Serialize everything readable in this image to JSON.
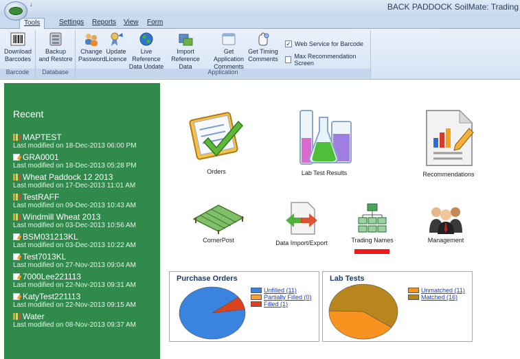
{
  "window": {
    "title": "BACK PADDOCK SoilMate: Trading"
  },
  "qat": {
    "glyph": "↓"
  },
  "menu": {
    "tabs": [
      "Tools",
      "Settings",
      "Reports",
      "View",
      "Form"
    ]
  },
  "ribbon": {
    "groups": [
      {
        "label": "Barcode",
        "buttons": [
          {
            "l1": "Download",
            "l2": "Barcodes"
          }
        ]
      },
      {
        "label": "Database",
        "buttons": [
          {
            "l1": "Backup",
            "l2": "and Restore"
          }
        ]
      },
      {
        "label": "Application",
        "buttons": [
          {
            "l1": "Change",
            "l2": "Password"
          },
          {
            "l1": "Update",
            "l2": "Licence"
          },
          {
            "l1": "Live Reference",
            "l2": "Data Update"
          },
          {
            "l1": "Import",
            "l2": "Reference Data"
          },
          {
            "l1": "Get Application",
            "l2": "Comments"
          },
          {
            "l1": "Get Timing",
            "l2": "Comments"
          }
        ]
      }
    ],
    "checkboxes": [
      {
        "label": "Web Service for Barcode",
        "checked": true,
        "mark": "✓"
      },
      {
        "label": "Max Recommendation Screen",
        "checked": false,
        "mark": ""
      }
    ]
  },
  "sidebar": {
    "title": "Recent",
    "items": [
      {
        "name": "MAPTEST",
        "sub": "Last modified on 18-Dec-2013 06:00 PM",
        "icon": "chart-icon"
      },
      {
        "name": "GRA0001",
        "sub": "Last modified on 18-Dec-2013 05:28 PM",
        "icon": "document-icon"
      },
      {
        "name": "Wheat Paddock 12 2013",
        "sub": "Last modified on 17-Dec-2013 11:01 AM",
        "icon": "chart-icon"
      },
      {
        "name": "TestRAFF",
        "sub": "Last modified on 09-Dec-2013 10:43 AM",
        "icon": "chart-icon"
      },
      {
        "name": "Windmill Wheat 2013",
        "sub": "Last modified on 03-Dec-2013 10:56 AM",
        "icon": "chart-icon"
      },
      {
        "name": "BSM031213KL",
        "sub": "Last modified on 03-Dec-2013 10:22 AM",
        "icon": "document-icon"
      },
      {
        "name": "Test7013KL",
        "sub": "Last modified on 27-Nov-2013 09:04 AM",
        "icon": "document-icon"
      },
      {
        "name": "7000Lee221113",
        "sub": "Last modified on 22-Nov-2013 09:31 AM",
        "icon": "document-icon"
      },
      {
        "name": "KatyTest221113",
        "sub": "Last modified on 22-Nov-2013 09:15 AM",
        "icon": "document-icon"
      },
      {
        "name": "Water",
        "sub": "Last modified on 08-Nov-2013 09:37 AM",
        "icon": "chart-icon"
      }
    ]
  },
  "tiles": {
    "orders": "Orders",
    "lab_test_results": "Lab Test Results",
    "recommendations": "Recommendations",
    "cornerpost": "CornerPost",
    "data_import_export": "Data Import/Export",
    "trading_names": "Trading Names",
    "management": "Management"
  },
  "purchase_orders": {
    "title": "Purchase Orders",
    "legend": [
      {
        "label": "Unfilled (11)",
        "value": 11,
        "color": "#3a84e0"
      },
      {
        "label": "Partially Filled (0)",
        "value": 0,
        "color": "#f4a23c"
      },
      {
        "label": "Filled (1)",
        "value": 1,
        "color": "#d9431e"
      }
    ]
  },
  "lab_tests": {
    "title": "Lab Tests",
    "legend": [
      {
        "label": "Unmatched (11)",
        "value": 11,
        "color": "#f7931e"
      },
      {
        "label": "Matched (16)",
        "value": 16,
        "color": "#b8861c"
      }
    ]
  },
  "colors": {
    "sidebar": "#2f8a4c",
    "panel_title": "#1a3a6b",
    "selection": "#f01818"
  }
}
